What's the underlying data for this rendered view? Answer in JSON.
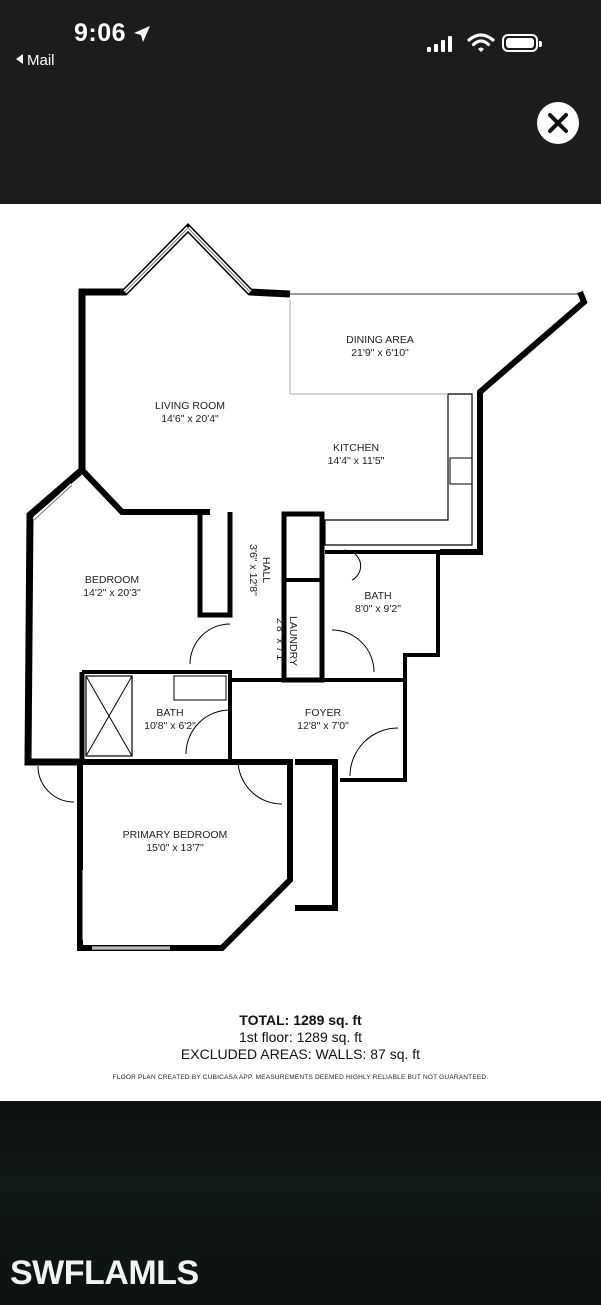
{
  "status_bar": {
    "time": "9:06",
    "back_label": "Mail"
  },
  "viewer": {
    "close_icon": "close-icon"
  },
  "floor_plan": {
    "rooms": [
      {
        "name": "DINING AREA",
        "size": "21'9\" x 6'10\""
      },
      {
        "name": "LIVING ROOM",
        "size": "14'6\" x 20'4\""
      },
      {
        "name": "KITCHEN",
        "size": "14'4\" x 11'5\""
      },
      {
        "name": "BEDROOM",
        "size": "14'2\" x 20'3\""
      },
      {
        "name": "BATH",
        "size": "8'0\" x 9'2\""
      },
      {
        "name": "BATH",
        "size": "10'8\" x 6'2\""
      },
      {
        "name": "FOYER",
        "size": "12'8\" x 7'0\""
      },
      {
        "name": "PRIMARY BEDROOM",
        "size": "15'0\" x 13'7\""
      },
      {
        "name": "HALL",
        "size": "3'6\" x 12'8\""
      },
      {
        "name": "LAUNDRY",
        "size": "2'8\" x 7'1\""
      }
    ],
    "total_label": "TOTAL:",
    "total_value": "1289 sq. ft",
    "floor_line": "1st floor: 1289 sq. ft",
    "excluded_line": "EXCLUDED AREAS: WALLS: 87 sq. ft",
    "disclaimer": "FLOOR PLAN CREATED BY CUBICASA APP. MEASUREMENTS DEEMED HIGHLY RELIABLE BUT NOT GUARANTEED."
  },
  "watermark": "SWFLAMLS",
  "colors": {
    "dark_bg": "#1c1c1c",
    "wall": "#000000",
    "paper": "#ffffff"
  }
}
